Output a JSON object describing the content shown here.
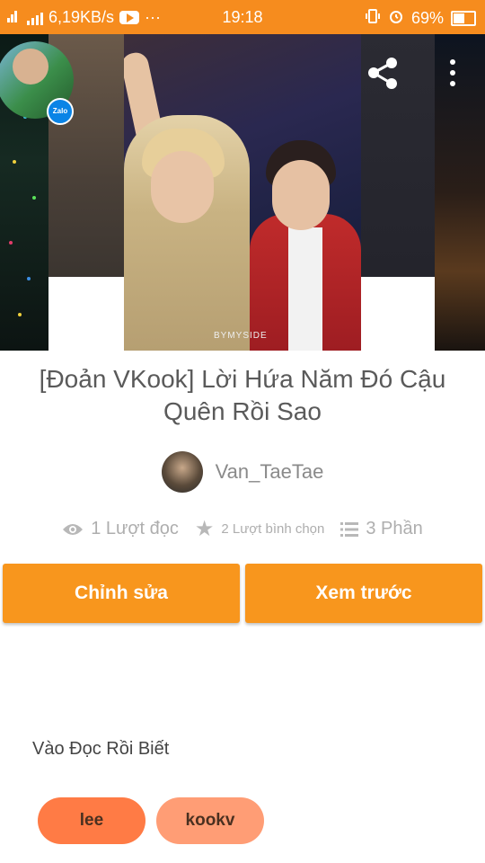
{
  "status_bar": {
    "network_speed": "6,19KB/s",
    "time": "19:18",
    "battery": "69%",
    "battery_level": 0.69,
    "more_glyph": "···",
    "icons": [
      "wifi-icon",
      "signal-icon",
      "youtube-icon",
      "vibrate-icon",
      "alarm-icon",
      "battery-icon"
    ]
  },
  "cover": {
    "watermark": "BYMYSIDE",
    "share_icon": "share-icon",
    "more_icon": "more-vert-icon"
  },
  "chathead": {
    "badge": "Zalo"
  },
  "story": {
    "title": "[Đoản VKook] Lời Hứa Năm Đó Cậu Quên Rồi Sao",
    "author": "Van_TaeTae",
    "reads": "1 Lượt đọc",
    "votes": "2 Lượt bình chọn",
    "parts": "3 Phần",
    "description": "Vào Đọc Rồi Biết"
  },
  "actions": {
    "edit_label": "Chỉnh sửa",
    "preview_label": "Xem trước"
  },
  "tags": [
    "lee",
    "kookv"
  ],
  "colors": {
    "accent": "#f68c1e",
    "button": "#f8961d",
    "tag_primary": "#ff7b45",
    "tag_secondary": "#ff9d75"
  }
}
